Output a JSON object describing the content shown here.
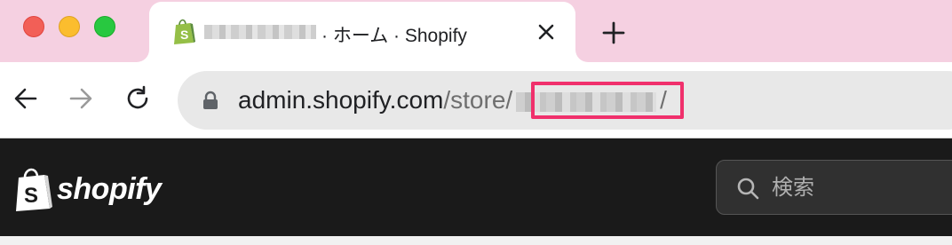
{
  "window": {
    "traffic_lights": [
      "close",
      "minimize",
      "zoom"
    ],
    "colors": {
      "tabstrip": "#f5d0e1",
      "close": "#f25f57",
      "minimize": "#fbbd2e",
      "zoom": "#28c840"
    }
  },
  "tab": {
    "title": "· ホーム · Shopify",
    "favicon": "shopify-bag-icon",
    "close_icon": "close-icon"
  },
  "toolbar": {
    "back_icon": "arrow-left-icon",
    "forward_icon": "arrow-right-icon",
    "reload_icon": "reload-icon",
    "new_tab_icon": "plus-icon"
  },
  "address_bar": {
    "lock_icon": "lock-icon",
    "host": "admin.shopify.com",
    "path_prefix": "/store/",
    "path_suffix": "/",
    "highlight_color": "#f0306c"
  },
  "shopify_header": {
    "logo_text": "shopify",
    "search": {
      "placeholder": "検索",
      "value": ""
    },
    "background": "#1a1a1a"
  }
}
